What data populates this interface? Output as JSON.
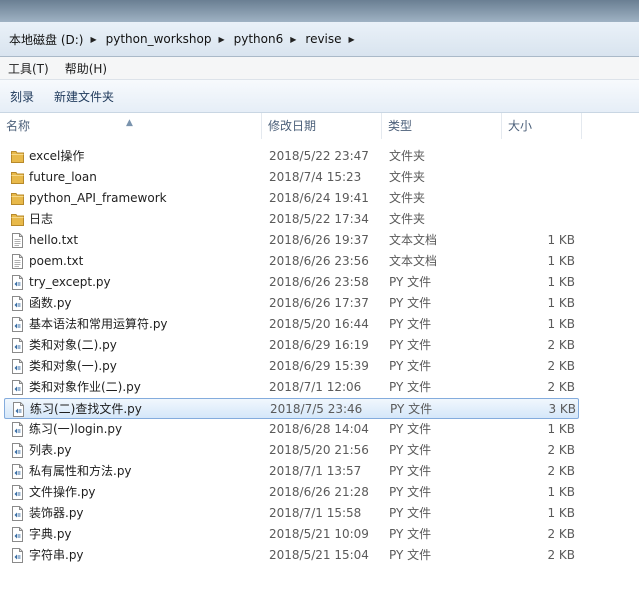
{
  "breadcrumb": [
    "本地磁盘 (D:)",
    "python_workshop",
    "python6",
    "revise"
  ],
  "menu": [
    "工具(T)",
    "帮助(H)"
  ],
  "toolbar": [
    "刻录",
    "新建文件夹"
  ],
  "columns": {
    "name": "名称",
    "date": "修改日期",
    "type": "类型",
    "size": "大小"
  },
  "files": [
    {
      "name": "excel操作",
      "date": "2018/5/22 23:47",
      "type": "文件夹",
      "size": "",
      "icon": "folder-icon"
    },
    {
      "name": "future_loan",
      "date": "2018/7/4 15:23",
      "type": "文件夹",
      "size": "",
      "icon": "folder-icon"
    },
    {
      "name": "python_API_framework",
      "date": "2018/6/24 19:41",
      "type": "文件夹",
      "size": "",
      "icon": "folder-icon"
    },
    {
      "name": "日志",
      "date": "2018/5/22 17:34",
      "type": "文件夹",
      "size": "",
      "icon": "folder-icon"
    },
    {
      "name": "hello.txt",
      "date": "2018/6/26 19:37",
      "type": "文本文档",
      "size": "1 KB",
      "icon": "text-file-icon"
    },
    {
      "name": "poem.txt",
      "date": "2018/6/26 23:56",
      "type": "文本文档",
      "size": "1 KB",
      "icon": "text-file-icon"
    },
    {
      "name": "try_except.py",
      "date": "2018/6/26 23:58",
      "type": "PY 文件",
      "size": "1 KB",
      "icon": "python-file-icon"
    },
    {
      "name": "函数.py",
      "date": "2018/6/26 17:37",
      "type": "PY 文件",
      "size": "1 KB",
      "icon": "python-file-icon"
    },
    {
      "name": "基本语法和常用运算符.py",
      "date": "2018/5/20 16:44",
      "type": "PY 文件",
      "size": "1 KB",
      "icon": "python-file-icon"
    },
    {
      "name": "类和对象(二).py",
      "date": "2018/6/29 16:19",
      "type": "PY 文件",
      "size": "2 KB",
      "icon": "python-file-icon"
    },
    {
      "name": "类和对象(一).py",
      "date": "2018/6/29 15:39",
      "type": "PY 文件",
      "size": "2 KB",
      "icon": "python-file-icon"
    },
    {
      "name": "类和对象作业(二).py",
      "date": "2018/7/1 12:06",
      "type": "PY 文件",
      "size": "2 KB",
      "icon": "python-file-icon"
    },
    {
      "name": "练习(二)查找文件.py",
      "date": "2018/7/5 23:46",
      "type": "PY 文件",
      "size": "3 KB",
      "icon": "python-file-icon",
      "selected": true
    },
    {
      "name": "练习(一)login.py",
      "date": "2018/6/28 14:04",
      "type": "PY 文件",
      "size": "1 KB",
      "icon": "python-file-icon"
    },
    {
      "name": "列表.py",
      "date": "2018/5/20 21:56",
      "type": "PY 文件",
      "size": "2 KB",
      "icon": "python-file-icon"
    },
    {
      "name": "私有属性和方法.py",
      "date": "2018/7/1 13:57",
      "type": "PY 文件",
      "size": "2 KB",
      "icon": "python-file-icon"
    },
    {
      "name": "文件操作.py",
      "date": "2018/6/26 21:28",
      "type": "PY 文件",
      "size": "1 KB",
      "icon": "python-file-icon"
    },
    {
      "name": "装饰器.py",
      "date": "2018/7/1 15:58",
      "type": "PY 文件",
      "size": "1 KB",
      "icon": "python-file-icon"
    },
    {
      "name": "字典.py",
      "date": "2018/5/21 10:09",
      "type": "PY 文件",
      "size": "2 KB",
      "icon": "python-file-icon"
    },
    {
      "name": "字符串.py",
      "date": "2018/5/21 15:04",
      "type": "PY 文件",
      "size": "2 KB",
      "icon": "python-file-icon"
    }
  ]
}
